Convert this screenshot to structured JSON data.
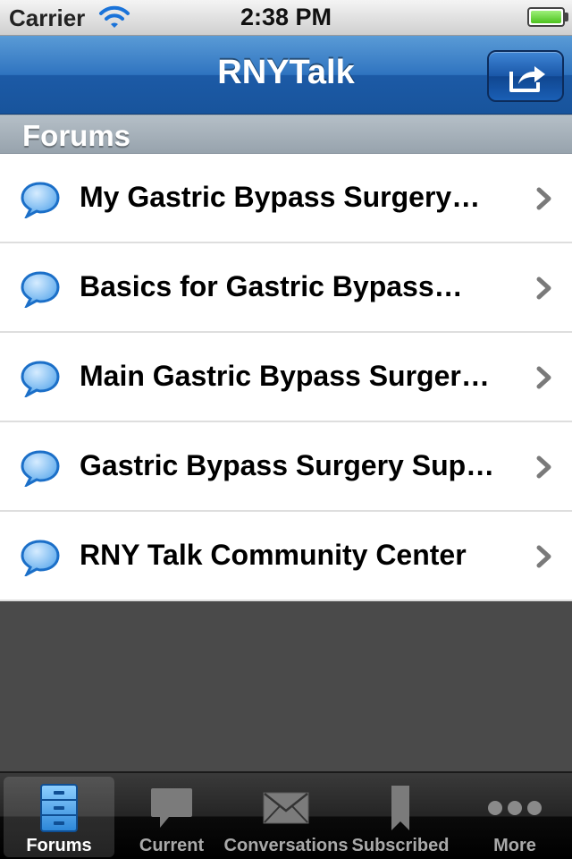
{
  "status_bar": {
    "carrier": "Carrier",
    "time": "2:38 PM"
  },
  "nav_bar": {
    "title": "RNYTalk",
    "right_button_icon": "share-icon"
  },
  "section": {
    "title": "Forums"
  },
  "forums": [
    {
      "label": "My Gastric Bypass Surgery…",
      "icon": "speech-bubble-icon"
    },
    {
      "label": "Basics for Gastric Bypass…",
      "icon": "speech-bubble-icon"
    },
    {
      "label": "Main Gastric Bypass Surger…",
      "icon": "speech-bubble-icon"
    },
    {
      "label": "Gastric Bypass Surgery Sup…",
      "icon": "speech-bubble-icon"
    },
    {
      "label": "RNY Talk Community Center",
      "icon": "speech-bubble-icon"
    }
  ],
  "tabs": [
    {
      "label": "Forums",
      "icon": "file-cabinet-icon",
      "selected": true
    },
    {
      "label": "Current",
      "icon": "chat-bubble-icon",
      "selected": false
    },
    {
      "label": "Conversations",
      "icon": "envelope-icon",
      "selected": false
    },
    {
      "label": "Subscribed",
      "icon": "bookmark-icon",
      "selected": false
    },
    {
      "label": "More",
      "icon": "more-dots-icon",
      "selected": false
    }
  ],
  "colors": {
    "nav_blue": "#2f74c0",
    "battery_green": "#4cc21e",
    "bubble_blue": "#3a8fe0"
  }
}
